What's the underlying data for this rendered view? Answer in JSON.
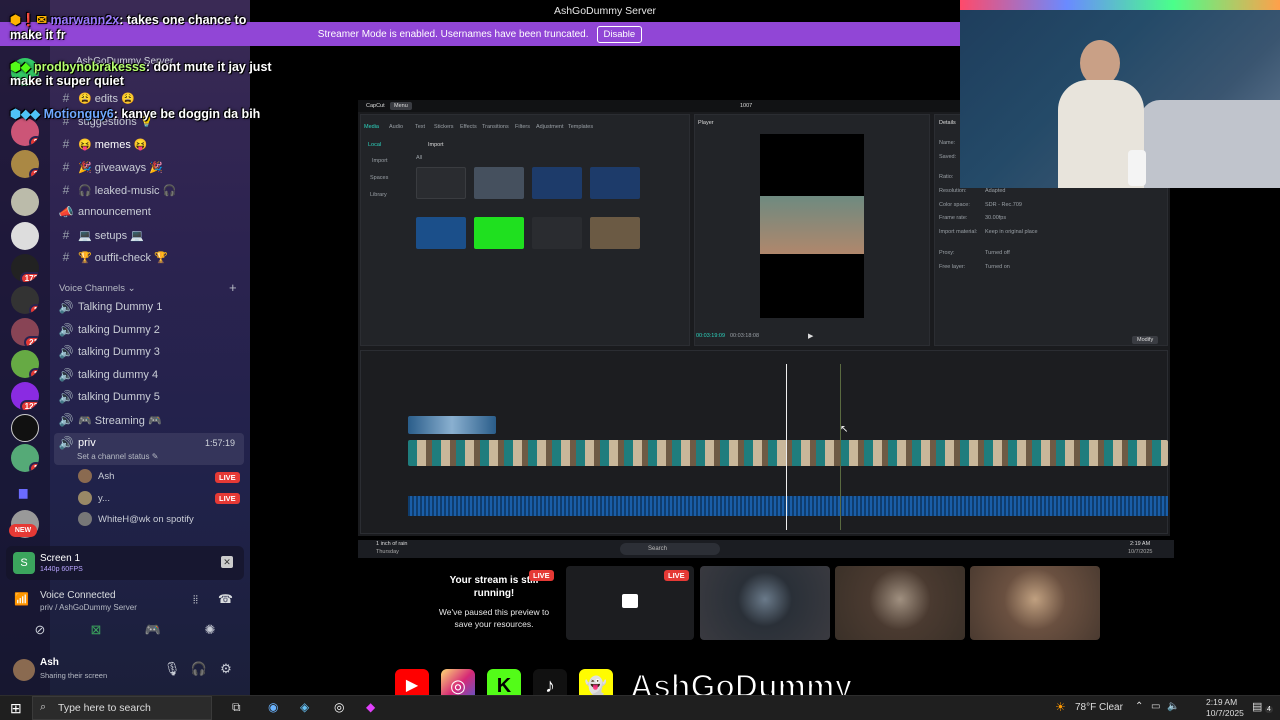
{
  "titlebar": {
    "text": "AshGoDummy Server"
  },
  "banner": {
    "message": "Streamer Mode is enabled. Usernames have been truncated.",
    "button": "Disable"
  },
  "chat": [
    {
      "user": "marwann2x",
      "msg": ": takes one chance to",
      "cont": "make it fr"
    },
    {
      "user": "prodbynobrakesss",
      "msg": ": dont mute it jay just",
      "cont": "make it super quiet"
    },
    {
      "user": "Motionguy6",
      "msg": ": kanye be doggin da bih"
    }
  ],
  "server_header": "AshGoDummy Server",
  "channels": [
    {
      "label": "😩 edits 😩",
      "icon": "#"
    },
    {
      "label": "suggestions 💡",
      "icon": "#"
    },
    {
      "label": "😝 memes 😝",
      "icon": "#"
    },
    {
      "label": "🎉 giveaways 🎉",
      "icon": "#"
    },
    {
      "label": "🎧 leaked-music 🎧",
      "icon": "#"
    },
    {
      "label": "announcement",
      "icon": "📣"
    },
    {
      "label": "💻 setups 💻",
      "icon": "#"
    },
    {
      "label": "🏆 outfit-check 🏆",
      "icon": "#"
    }
  ],
  "voice_section": "Voice Channels",
  "voice_channels": [
    "Talking Dummy 1",
    "talking Dummy 2",
    "talking Dummy 3",
    "talking dummy 4",
    "talking Dummy 5",
    "🎮 Streaming 🎮"
  ],
  "priv": {
    "name": "priv",
    "time": "1:57:19",
    "status": "Set a channel status"
  },
  "voice_users": [
    {
      "name": "Ash",
      "live": "LIVE"
    },
    {
      "name": "y...",
      "live": "LIVE"
    },
    {
      "name": "WhiteH@wk on spotify",
      "live": ""
    }
  ],
  "guild_badges": [
    "1",
    "2",
    "2",
    "1",
    "172",
    "1",
    "21",
    "1",
    "123",
    "1"
  ],
  "new_badge": "NEW",
  "screen": {
    "title": "Screen 1",
    "sub": "1440p 60FPS"
  },
  "voice": {
    "title": "Voice Connected",
    "sub": "priv / AshGoDummy Server"
  },
  "user": {
    "name": "Ash",
    "status": "Sharing their screen"
  },
  "editor": {
    "app": "CapCut",
    "menu": "Menu",
    "project": "1007",
    "player": "Player",
    "details": "Details",
    "tabs": [
      "Media",
      "Audio",
      "Text",
      "Stickers",
      "Effects",
      "Transitions",
      "Filters",
      "Adjustment",
      "Templates"
    ],
    "side": [
      "Local",
      "Import",
      "Spaces",
      "Library"
    ],
    "import": "Import",
    "all": "All",
    "detail_rows": [
      [
        "Name:",
        ""
      ],
      [
        "Saved:",
        ""
      ],
      [
        "Ratio:",
        ""
      ],
      [
        "Resolution:",
        "Adapted"
      ],
      [
        "Color space:",
        "SDR - Rec.709"
      ],
      [
        "Frame rate:",
        "30.00fps"
      ],
      [
        "Import material:",
        "Keep in original place"
      ],
      [
        "Proxy:",
        "Turned off"
      ],
      [
        "Free layer:",
        "Turned on"
      ]
    ],
    "modify": "Modify",
    "time_cur": "00:03:19:09",
    "time_total": "00:03:18:08"
  },
  "minitask": {
    "weather": "1 inch of rain",
    "day": "Thursday",
    "search": "Search",
    "time": "2:19 AM",
    "date": "10/7/2025"
  },
  "previews": {
    "paused_title": "Your stream is still running!",
    "paused_body": "We've paused this preview to save your resources.",
    "live": "LIVE"
  },
  "social": {
    "name": "AshGoDummy"
  },
  "taskbar": {
    "search": "Type here to search",
    "weather": "78°F",
    "sky": "Clear",
    "time": "2:19 AM",
    "date": "10/7/2025",
    "notif": "4"
  }
}
